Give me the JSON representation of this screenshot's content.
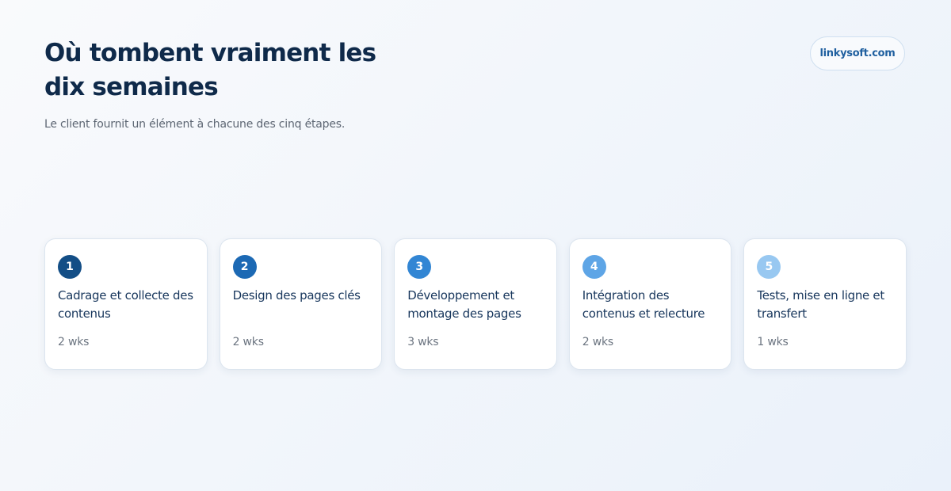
{
  "header": {
    "title": "Où tombent vraiment les dix semaines",
    "subtitle": "Le client fournit un élément à chacune des cinq étapes."
  },
  "brand": {
    "label": "linkysoft.com"
  },
  "steps": [
    {
      "number": "1",
      "title": "Cadrage et collecte des contenus",
      "duration": "2 wks",
      "color": "#134e86"
    },
    {
      "number": "2",
      "title": "Design des pages clés",
      "duration": "2 wks",
      "color": "#1c69b4"
    },
    {
      "number": "3",
      "title": "Développement et montage des pages",
      "duration": "3 wks",
      "color": "#3286d4"
    },
    {
      "number": "4",
      "title": "Intégration des contenus et relecture",
      "duration": "2 wks",
      "color": "#5ea5e6"
    },
    {
      "number": "5",
      "title": "Tests, mise en ligne et transfert",
      "duration": "1 wks",
      "color": "#98c8f1"
    }
  ]
}
